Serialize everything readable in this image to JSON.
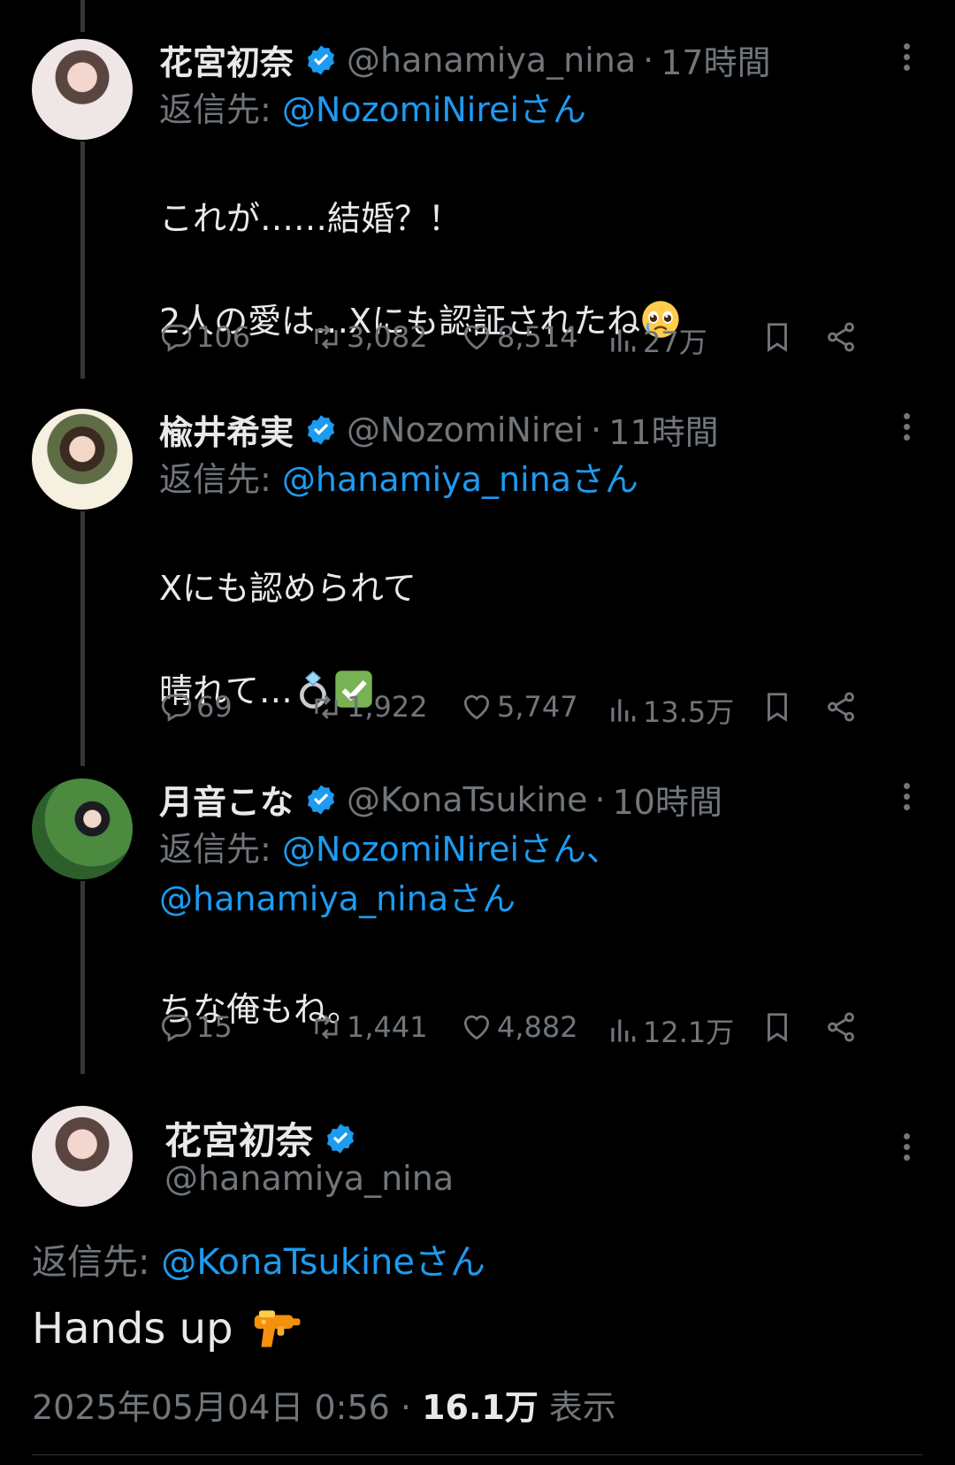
{
  "colors": {
    "accent": "#1d9bf0",
    "muted": "#71767b",
    "text": "#e7e9ea",
    "background": "#000000"
  },
  "replies": [
    {
      "name": "花宮初奈",
      "handle": "@hanamiya_nina",
      "time": "17時間",
      "reply_label": "返信先: ",
      "reply_mentions": "@NozomiNireiさん",
      "text": "これが……結婚？！\n\n2人の愛は…Xにも認証されたね",
      "emoji": "pleading-face",
      "stats": {
        "replies": "106",
        "reposts": "3,082",
        "likes": "8,514",
        "views": "27万"
      }
    },
    {
      "name": "楡井希実",
      "handle": "@NozomiNirei",
      "time": "11時間",
      "reply_label": "返信先: ",
      "reply_mentions": "@hanamiya_ninaさん",
      "text": "Xにも認められて\n\n晴れて…",
      "emoji": "ring-checkmark",
      "stats": {
        "replies": "69",
        "reposts": "1,922",
        "likes": "5,747",
        "views": "13.5万"
      }
    },
    {
      "name": "月音こな",
      "handle": "@KonaTsukine",
      "time": "10時間",
      "reply_label": "返信先: ",
      "reply_mentions_line1": "@NozomiNireiさん、",
      "reply_mentions_line2": "@hanamiya_ninaさん",
      "text": "ちな俺もね。",
      "stats": {
        "replies": "15",
        "reposts": "1,441",
        "likes": "4,882",
        "views": "12.1万"
      }
    }
  ],
  "main": {
    "name": "花宮初奈",
    "handle": "@hanamiya_nina",
    "reply_label": "返信先: ",
    "reply_mention": "@KonaTsukineさん",
    "text": "Hands up",
    "emoji": "water-pistol",
    "date": "2025年05月04日 0:56 · ",
    "views": "16.1万",
    "views_label": " 表示"
  }
}
